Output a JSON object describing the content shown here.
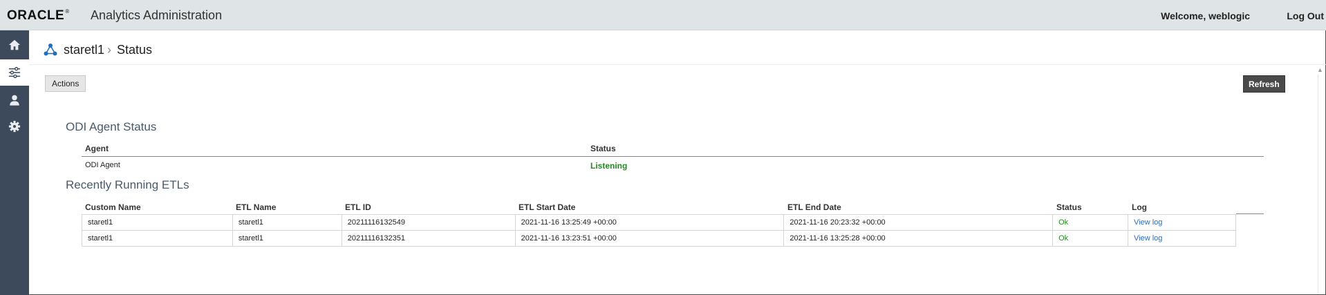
{
  "header": {
    "brand": "ORACLE",
    "app_title": "Analytics Administration",
    "welcome": "Welcome, weblogic",
    "logout": "Log Out"
  },
  "sidebar": {
    "items": [
      {
        "name": "home",
        "icon": "home-icon",
        "active": false
      },
      {
        "name": "configuration",
        "icon": "sliders-icon",
        "active": true
      },
      {
        "name": "users",
        "icon": "user-icon",
        "active": false
      },
      {
        "name": "settings",
        "icon": "gear-icon",
        "active": false
      }
    ],
    "bg_color": "#3d4a5c"
  },
  "breadcrumb": {
    "root": "staretl1",
    "separator": "›",
    "current": "Status",
    "icon": "network-icon"
  },
  "toolbar": {
    "actions_label": "Actions",
    "refresh_label": "Refresh"
  },
  "odi_agent": {
    "title": "ODI Agent Status",
    "columns": [
      "Agent",
      "Status"
    ],
    "rows": [
      {
        "agent": "ODI Agent",
        "status": "Listening"
      }
    ]
  },
  "etls": {
    "title": "Recently Running ETLs",
    "columns": [
      "Custom Name",
      "ETL Name",
      "ETL ID",
      "ETL Start Date",
      "ETL End Date",
      "Status",
      "Log"
    ],
    "rows": [
      {
        "custom_name": "staretl1",
        "etl_name": "staretl1",
        "etl_id": "20211116132549",
        "start": "2021-11-16 13:25:49 +00:00",
        "end": "2021-11-16 20:23:32 +00:00",
        "status": "Ok",
        "log": "View log"
      },
      {
        "custom_name": "staretl1",
        "etl_name": "staretl1",
        "etl_id": "20211116132351",
        "start": "2021-11-16 13:23:51 +00:00",
        "end": "2021-11-16 13:25:28 +00:00",
        "status": "Ok",
        "log": "View log"
      }
    ]
  },
  "colors": {
    "ok": "#218a21",
    "link": "#2f6db3",
    "accent": "#2f6db3"
  }
}
